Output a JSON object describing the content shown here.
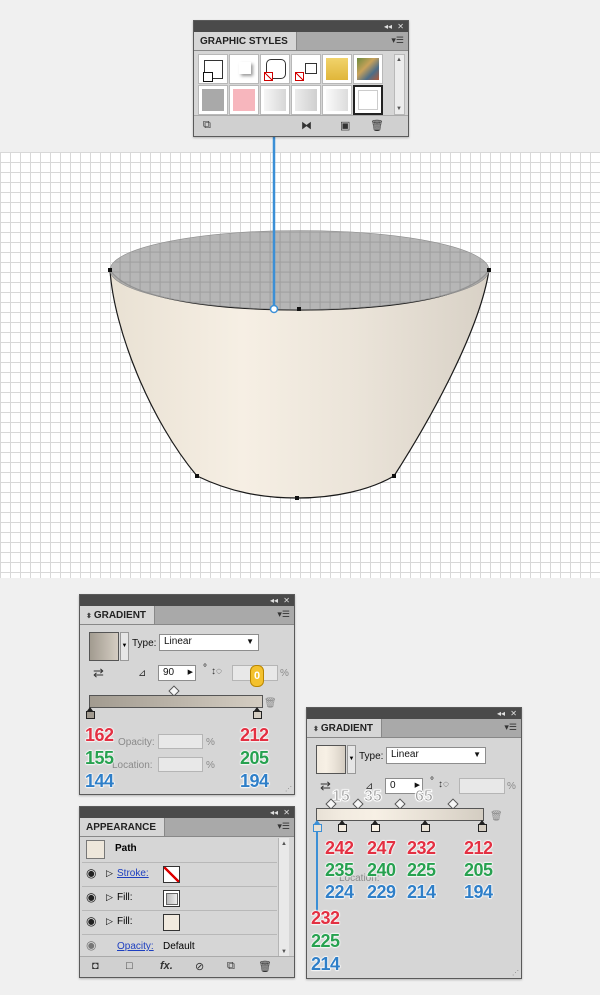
{
  "graphic_styles": {
    "title": "GRAPHIC STYLES",
    "menu_icon": "panel-menu-icon",
    "swatches_row1": [
      "default-style",
      "shadow-style",
      "rounded-style",
      "none-style",
      "yellow-style",
      "texture-style"
    ],
    "swatches_row2": [
      "gray-fill",
      "pink-fill",
      "light-gradient",
      "light-gradient-2",
      "light-gradient-3",
      "white-box"
    ],
    "bottom_icons": [
      "library-icon",
      "break-link-icon",
      "new-style-icon",
      "trash-icon"
    ]
  },
  "gradient_left": {
    "title": "GRADIENT",
    "type_label": "Type:",
    "type_value": "Linear",
    "angle_value": "90",
    "degree_symbol": "°",
    "aspect_value": "0",
    "percent": "%",
    "opacity_label": "Opacity:",
    "location_label": "Location:",
    "left_stop": {
      "r": "162",
      "g": "155",
      "b": "144"
    },
    "right_stop": {
      "r": "212",
      "g": "205",
      "b": "194"
    }
  },
  "gradient_right": {
    "title": "GRADIENT",
    "type_label": "Type:",
    "type_value": "Linear",
    "angle_value": "0",
    "degree_symbol": "°",
    "percent": "%",
    "location_label": "Location:",
    "stop_locations": [
      "15",
      "35",
      "65"
    ],
    "stops": [
      {
        "r": "242",
        "g": "235",
        "b": "224"
      },
      {
        "r": "247",
        "g": "240",
        "b": "229"
      },
      {
        "r": "232",
        "g": "225",
        "b": "214"
      },
      {
        "r": "212",
        "g": "205",
        "b": "194"
      }
    ],
    "first_stop": {
      "r": "232",
      "g": "225",
      "b": "214"
    }
  },
  "appearance": {
    "title": "APPEARANCE",
    "path_label": "Path",
    "rows": [
      {
        "label": "Stroke:",
        "linked": true
      },
      {
        "label": "Fill:",
        "linked": false
      },
      {
        "label": "Fill:",
        "linked": false
      }
    ],
    "opacity_label": "Opacity:",
    "opacity_value": "Default",
    "bottom_icons": [
      "new-art-icon",
      "clear-icon",
      "fx-icon",
      "no-icon",
      "duplicate-icon",
      "trash-icon"
    ],
    "fx_text": "fx."
  },
  "colors": {
    "red": "#e33042",
    "green": "#27a150",
    "blue": "#2f7fc8",
    "guide_blue": "#3b8fd6",
    "bowl_light": "#f2ebe0",
    "bowl_dark": "#d4cdc2",
    "rim_gray": "#a29b90"
  }
}
